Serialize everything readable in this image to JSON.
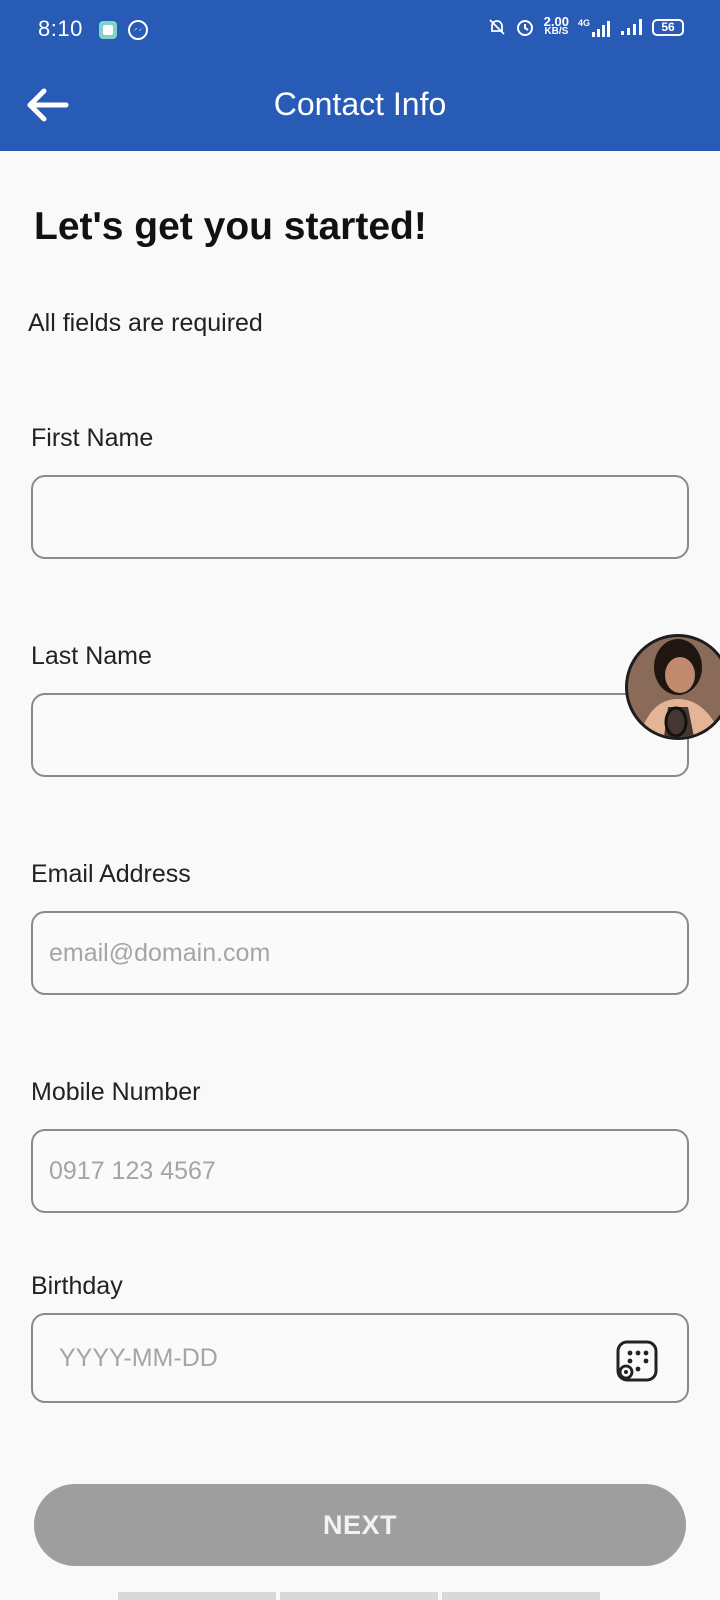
{
  "status_bar": {
    "time": "8:10",
    "speed_value": "2.00",
    "speed_unit": "KB/S",
    "network_label": "4G",
    "battery": "56",
    "icons": [
      "app-notification-icon",
      "messenger-icon",
      "mute-bell-icon",
      "alarm-icon",
      "signal-4g-icon",
      "signal-icon",
      "battery-icon"
    ]
  },
  "app_bar": {
    "title": "Contact Info",
    "back_icon": "arrow-left-icon"
  },
  "form": {
    "heading": "Let's get you started!",
    "subtext": "All fields are required",
    "first_name": {
      "label": "First Name",
      "value": "",
      "placeholder": ""
    },
    "last_name": {
      "label": "Last Name",
      "value": "",
      "placeholder": ""
    },
    "email": {
      "label": "Email Address",
      "value": "",
      "placeholder": "email@domain.com"
    },
    "mobile": {
      "label": "Mobile Number",
      "value": "",
      "placeholder": "0917 123 4567"
    },
    "birthday": {
      "label": "Birthday",
      "value": "",
      "placeholder": "YYYY-MM-DD",
      "icon": "calendar-icon"
    }
  },
  "next_button": {
    "label": "NEXT"
  },
  "colors": {
    "primary": "#275bb5",
    "button_disabled": "#9e9e9e",
    "background": "#f9f9f9"
  }
}
